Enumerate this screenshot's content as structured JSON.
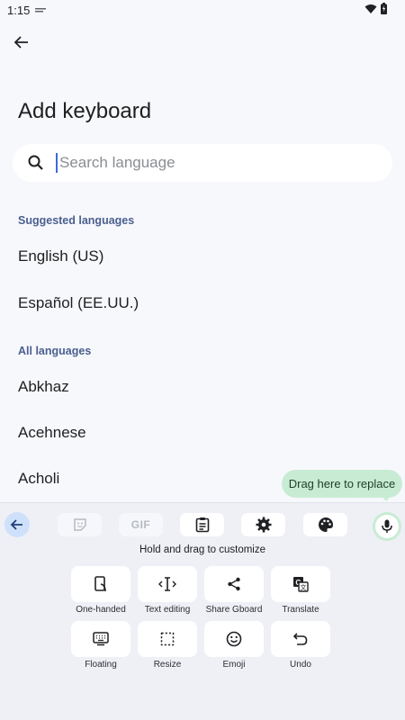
{
  "status": {
    "time": "1:15"
  },
  "header": {
    "title": "Add keyboard"
  },
  "search": {
    "placeholder": "Search language"
  },
  "sections": {
    "suggested": {
      "header": "Suggested languages",
      "items": [
        "English (US)",
        "Español (EE.UU.)"
      ]
    },
    "all": {
      "header": "All languages",
      "items": [
        "Abkhaz",
        "Acehnese",
        "Acholi"
      ]
    }
  },
  "keyboard": {
    "tooltip": "Drag here to replace",
    "hint": "Hold and drag to customize",
    "toolbar": {
      "gif_label": "GIF",
      "icons": [
        "back-arrow-icon",
        "sticker-icon",
        "gif-icon",
        "clipboard-icon",
        "gear-icon",
        "palette-icon",
        "mic-icon"
      ]
    },
    "tiles": [
      {
        "label": "One-handed",
        "icon": "one-handed-icon"
      },
      {
        "label": "Text editing",
        "icon": "text-editing-icon"
      },
      {
        "label": "Share Gboard",
        "icon": "share-icon"
      },
      {
        "label": "Translate",
        "icon": "translate-icon"
      },
      {
        "label": "Floating",
        "icon": "floating-keyboard-icon"
      },
      {
        "label": "Resize",
        "icon": "resize-icon"
      },
      {
        "label": "Emoji",
        "icon": "emoji-icon"
      },
      {
        "label": "Undo",
        "icon": "undo-icon"
      }
    ]
  },
  "colors": {
    "background": "#f7f8fc",
    "section_header": "#4a5f8f",
    "accent_blue": "#cfe0fb",
    "mic_green": "#c8ecd3"
  }
}
